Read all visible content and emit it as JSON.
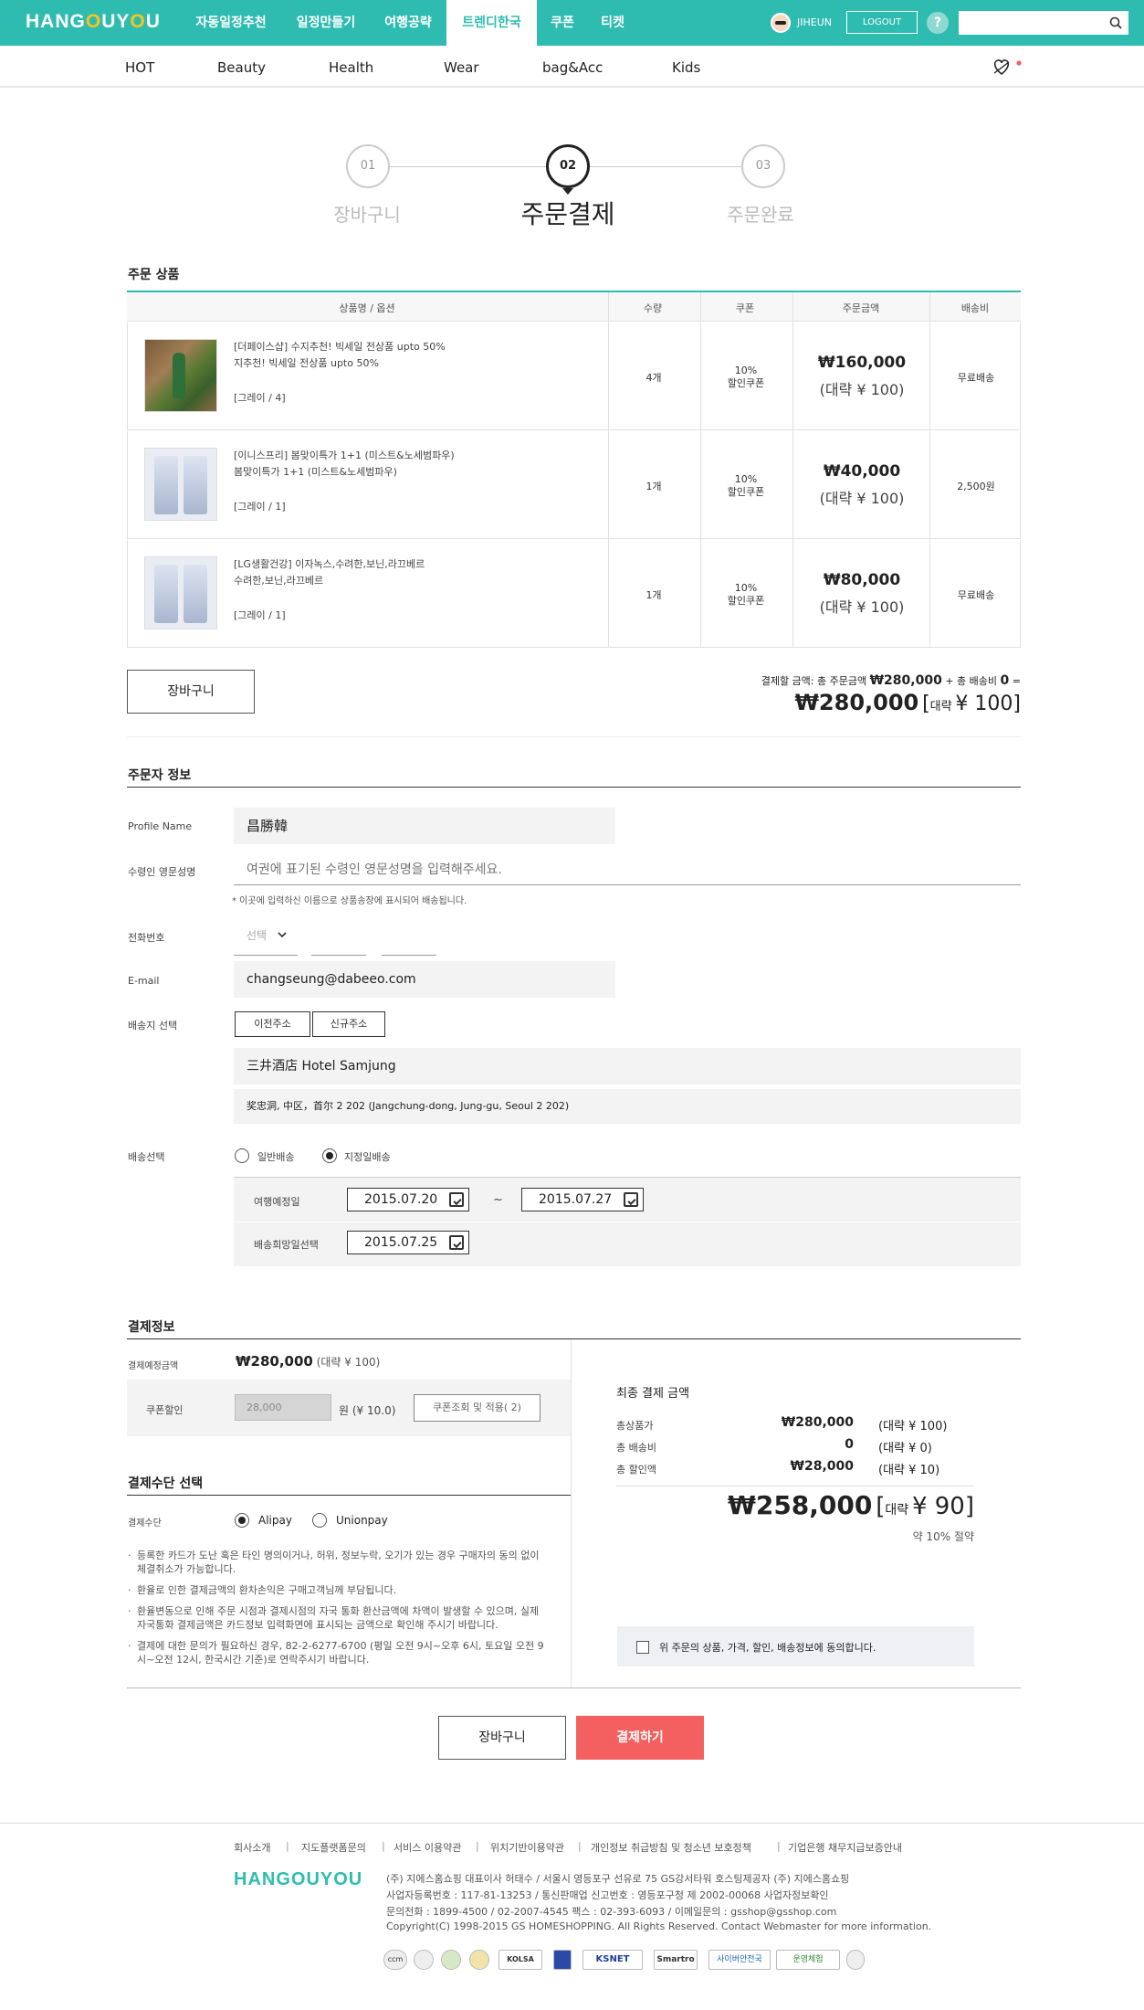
{
  "header": {
    "logo_left": "HANG",
    "logo_o": "O",
    "logo_right": "UY",
    "logo_o2": "O",
    "logo_u": "U",
    "nav": [
      "자동일정추천",
      "일정만들기",
      "여행공략",
      "트렌디한국",
      "쿠폰",
      "티켓"
    ],
    "active_nav": "트렌디한국",
    "user": "JIHEUN",
    "logout": "LOGOUT",
    "help": "?",
    "search_placeholder": ""
  },
  "subnav": [
    "HOT",
    "Beauty",
    "Health",
    "Wear",
    "bag&Acc",
    "Kids"
  ],
  "steps": [
    {
      "num": "01",
      "label": "장바구니"
    },
    {
      "num": "02",
      "label": "주문결제"
    },
    {
      "num": "03",
      "label": "주문완료"
    }
  ],
  "order_section": {
    "title": "주문 상품",
    "columns": [
      "상품명 / 옵션",
      "수량",
      "쿠폰",
      "주문금액",
      "배송비"
    ],
    "items": [
      {
        "name1": "[더페이스샵] 수지추천! 빅세일 전상품 upto 50%",
        "name2": "지추천! 빅세일 전상품 upto 50%",
        "option": "[그레이 / 4]",
        "qty": "4개",
        "coupon1": "10%",
        "coupon2": "할인쿠폰",
        "price": "₩160,000",
        "price_cny": "(대략 ¥ 100)",
        "ship": "무료배송"
      },
      {
        "name1": "[이니스프리] 봄맞이특가 1+1 (미스트&노세범파우)",
        "name2": "봄맞이특가 1+1 (미스트&노세범파우)",
        "option": "[그레이 / 1]",
        "qty": "1개",
        "coupon1": "10%",
        "coupon2": "할인쿠폰",
        "price": "₩40,000",
        "price_cny": "(대략 ¥ 100)",
        "ship": "2,500원"
      },
      {
        "name1": "[LG생활건강] 이자녹스,수려한,보닌,라끄베르",
        "name2": "수려한,보닌,라끄베르",
        "option": "[그레이 / 1]",
        "qty": "1개",
        "coupon1": "10%",
        "coupon2": "할인쿠폰",
        "price": "₩80,000",
        "price_cny": "(대략 ¥ 100)",
        "ship": "무료배송"
      }
    ],
    "cart_button": "장바구니",
    "summary_line": "결제할 금액: 총 주문금액",
    "summary_amount": "₩280,000",
    "summary_ship": "+ 총 배송비",
    "summary_ship_amount": "0",
    "summary_eq": "=",
    "total": "₩280,000",
    "total_cny_open": "[",
    "total_cny_label": "대략",
    "total_cny_value": "¥ 100",
    "total_cny_close": "]"
  },
  "orderer": {
    "title": "주문자 정보",
    "profile_label": "Profile Name",
    "profile_value": "昌勝韓",
    "eng_label": "수령인 영문성명",
    "eng_placeholder": "여권에 표기된 수령인 영문성명을 입력해주세요.",
    "eng_note": "* 이곳에 입력하신 이름으로 상품송장에 표시되어 배송됩니다.",
    "phone_label": "전화번호",
    "phone_select": "선택",
    "email_label": "E-mail",
    "email_value": "changseung@dabeeo.com",
    "addr_label": "배송지 선택",
    "addr_btn1": "이전주소",
    "addr_btn2": "신규주소",
    "addr_name": "三井酒店 Hotel Samjung",
    "addr_detail": "奖忠洞, 中区，首尔 2 202 (Jangchung-dong, Jung-gu, Seoul 2 202)",
    "ship_label": "배송선택",
    "ship_opt1": "일반배송",
    "ship_opt2": "지정일배송",
    "travel_label": "여행예정일",
    "travel_from": "2015.07.20",
    "tilde": "~",
    "travel_to": "2015.07.27",
    "wish_label": "배송희망일선택",
    "wish_date": "2015.07.25"
  },
  "payment": {
    "title": "결제정보",
    "expected_label": "결제예정금액",
    "expected_value": "₩280,000",
    "expected_cny": "(대략 ¥ 100)",
    "coupon_label": "쿠폰할인",
    "coupon_value": "28,000",
    "coupon_unit": "원 (¥ 10.0)",
    "coupon_btn": "쿠폰조회 및 적용( 2)",
    "method_title": "결제수단 선택",
    "method_label": "결제수단",
    "method1": "Alipay",
    "method2": "Unionpay",
    "notes": [
      "등록한 카드가 도난 혹은 타인 명의이거나, 허위, 정보누락, 오기가 있는 경우 구매자의 동의 없이 체결취소가 가능합니다.",
      "환율로 인한 결제금액의 환차손익은 구매고객님께 부담됩니다.",
      "환율변동으로 인해 주문 시점과 결제시점의 자국 통화 환산금액에 차액이 발생할 수 있으며, 실제 자국통화 결제금액은 카드정보 입력화면에 표시되는 금액으로 확인해 주시기 바랍니다.",
      "결제에 대한 문의가 필요하신 경우, 82-2-6277-6700 (평일 오전 9시~오후 6시, 토요일 오전 9시~오전 12시, 한국시간 기준)로 연락주시기 바랍니다."
    ],
    "final_title": "최종 결제 금액",
    "rows": [
      {
        "label": "총상품가",
        "value": "₩280,000",
        "cny": "(대략 ¥ 100)"
      },
      {
        "label": "총 배송비",
        "value": "0",
        "cny": "(대략 ¥ 0)"
      },
      {
        "label": "총 할인액",
        "value": "₩28,000",
        "cny": "(대략 ¥ 10)"
      }
    ],
    "final_total": "₩258,000",
    "final_cny_open": "[",
    "final_cny_label": "대략",
    "final_cny_value": "¥ 90",
    "final_cny_close": "]",
    "final_save": "약 10% 절약",
    "agree": "위 주문의 상품, 가격, 할인, 배송정보에 동의합니다."
  },
  "actions": {
    "cart": "장바구니",
    "pay": "결제하기"
  },
  "footer": {
    "links": [
      "회사소개",
      "지도플랫폼문의",
      "서비스 이용약관",
      "위치기반이용약관",
      "개인정보 취급방침 및 청소년 보호정책",
      "기업은행 채무지급보증안내"
    ],
    "sep": "|",
    "logo": "HANGOUYOU",
    "info": [
      "(주) 지에스홈쇼핑 대표이사 허태수 / 서울시 영등포구 선유로 75 GS강서타워 호스팅제공자 (주) 지에스홈쇼핑",
      "사업자등록번호 : 117-81-13253 / 통신판매업 신고번호 : 영등포구청 제 2002-00068 사업자정보확인",
      "문의전화 : 1899-4500 / 02-2007-4545 팩스 : 02-393-6093 / 이메일문의 : gsshop@gsshop.com",
      "Copyright(C) 1998-2015 GS HOMESHOPPING. All Rights Reserved. Contact Webmaster for more information."
    ],
    "badges": [
      "ccm",
      "",
      "",
      "",
      "KOLSA",
      "",
      "KSNET",
      "Smartro",
      "사이버안전국",
      "운영체험",
      ""
    ]
  },
  "colors": {
    "brand": "#2fbcb0",
    "accent": "#f45f5f",
    "logo_o": "#f7c520"
  }
}
